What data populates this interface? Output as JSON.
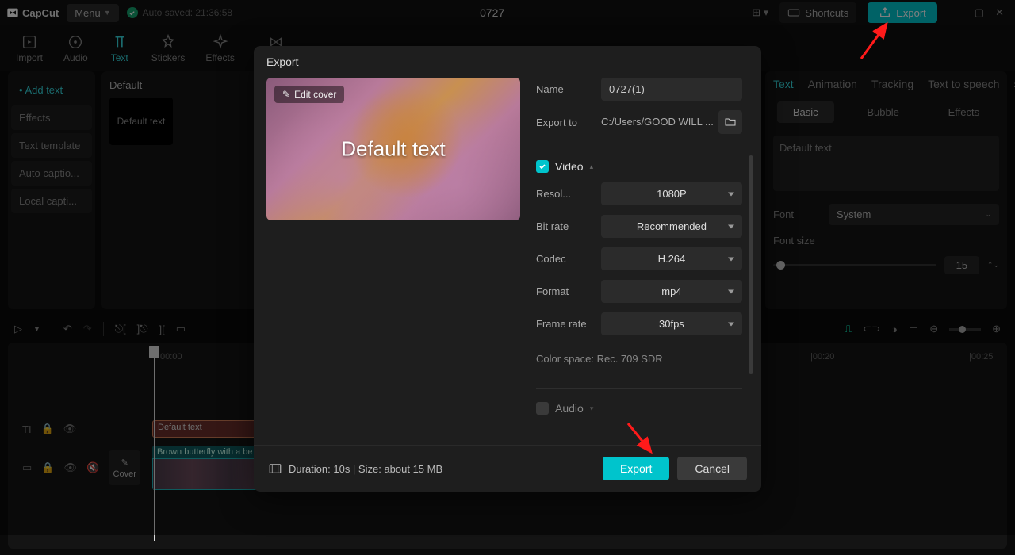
{
  "titlebar": {
    "app": "CapCut",
    "menu": "Menu",
    "autosave": "Auto saved: 21:36:58",
    "project": "0727",
    "shortcuts": "Shortcuts",
    "export": "Export"
  },
  "tooltabs": [
    {
      "label": "Import"
    },
    {
      "label": "Audio"
    },
    {
      "label": "Text",
      "active": true
    },
    {
      "label": "Stickers"
    },
    {
      "label": "Effects"
    },
    {
      "label": "Transition"
    }
  ],
  "text_side_tabs": [
    {
      "label": "Add text",
      "active": true
    },
    {
      "label": "Effects"
    },
    {
      "label": "Text template"
    },
    {
      "label": "Auto captio..."
    },
    {
      "label": "Local capti..."
    }
  ],
  "asset": {
    "heading": "Default",
    "thumb_label": "Default text"
  },
  "right_panel": {
    "tabs": [
      "Text",
      "Animation",
      "Tracking",
      "Text to speech"
    ],
    "active_tab": "Text",
    "subtabs": [
      "Basic",
      "Bubble",
      "Effects"
    ],
    "active_subtab": "Basic",
    "sample_text": "Default text",
    "font_label": "Font",
    "font_value": "System",
    "fontsize_label": "Font size",
    "fontsize_value": "15"
  },
  "timeline": {
    "ruler": [
      "00:00",
      "|00:20",
      "|00:25"
    ],
    "text_clip": "Default text",
    "video_clip": "Brown butterfly with a be",
    "cover": "Cover"
  },
  "export": {
    "title": "Export",
    "cover_button": "Edit cover",
    "cover_text": "Default text",
    "name_label": "Name",
    "name_value": "0727(1)",
    "exportto_label": "Export to",
    "exportto_value": "C:/Users/GOOD WILL ...",
    "video_section": "Video",
    "audio_section": "Audio",
    "fields": {
      "resolution": {
        "label": "Resol...",
        "value": "1080P"
      },
      "bitrate": {
        "label": "Bit rate",
        "value": "Recommended"
      },
      "codec": {
        "label": "Codec",
        "value": "H.264"
      },
      "format": {
        "label": "Format",
        "value": "mp4"
      },
      "framerate": {
        "label": "Frame rate",
        "value": "30fps"
      }
    },
    "colorspace": "Color space: Rec. 709 SDR",
    "footer_info": "Duration: 10s | Size: about 15 MB",
    "export_btn": "Export",
    "cancel_btn": "Cancel"
  }
}
